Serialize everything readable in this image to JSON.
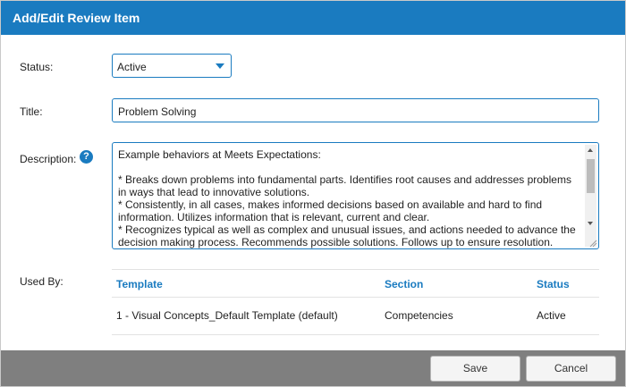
{
  "dialog": {
    "title": "Add/Edit Review Item",
    "colors": {
      "accent": "#1a7bc0",
      "footer": "#7f7f7f"
    }
  },
  "form": {
    "status_label": "Status:",
    "status_value": "Active",
    "title_label": "Title:",
    "title_value": "Problem Solving",
    "description_label": "Description:",
    "help_icon": "?",
    "description_value": "Example behaviors at Meets Expectations:\n\n* Breaks down problems into fundamental parts. Identifies root causes and addresses problems in ways that lead to innovative solutions.\n* Consistently, in all cases, makes informed decisions based on available and hard to find information. Utilizes information that is relevant, current and clear.\n* Recognizes typical as well as complex and unusual issues, and actions needed to advance the decision making process. Recommends possible solutions. Follows up to ensure resolution.",
    "used_by_label": "Used By:"
  },
  "used_by": {
    "columns": [
      "Template",
      "Section",
      "Status"
    ],
    "rows": [
      {
        "template": "1 - Visual Concepts_Default Template (default)",
        "section": "Competencies",
        "status": "Active"
      }
    ]
  },
  "footer": {
    "save_label": "Save",
    "cancel_label": "Cancel"
  }
}
